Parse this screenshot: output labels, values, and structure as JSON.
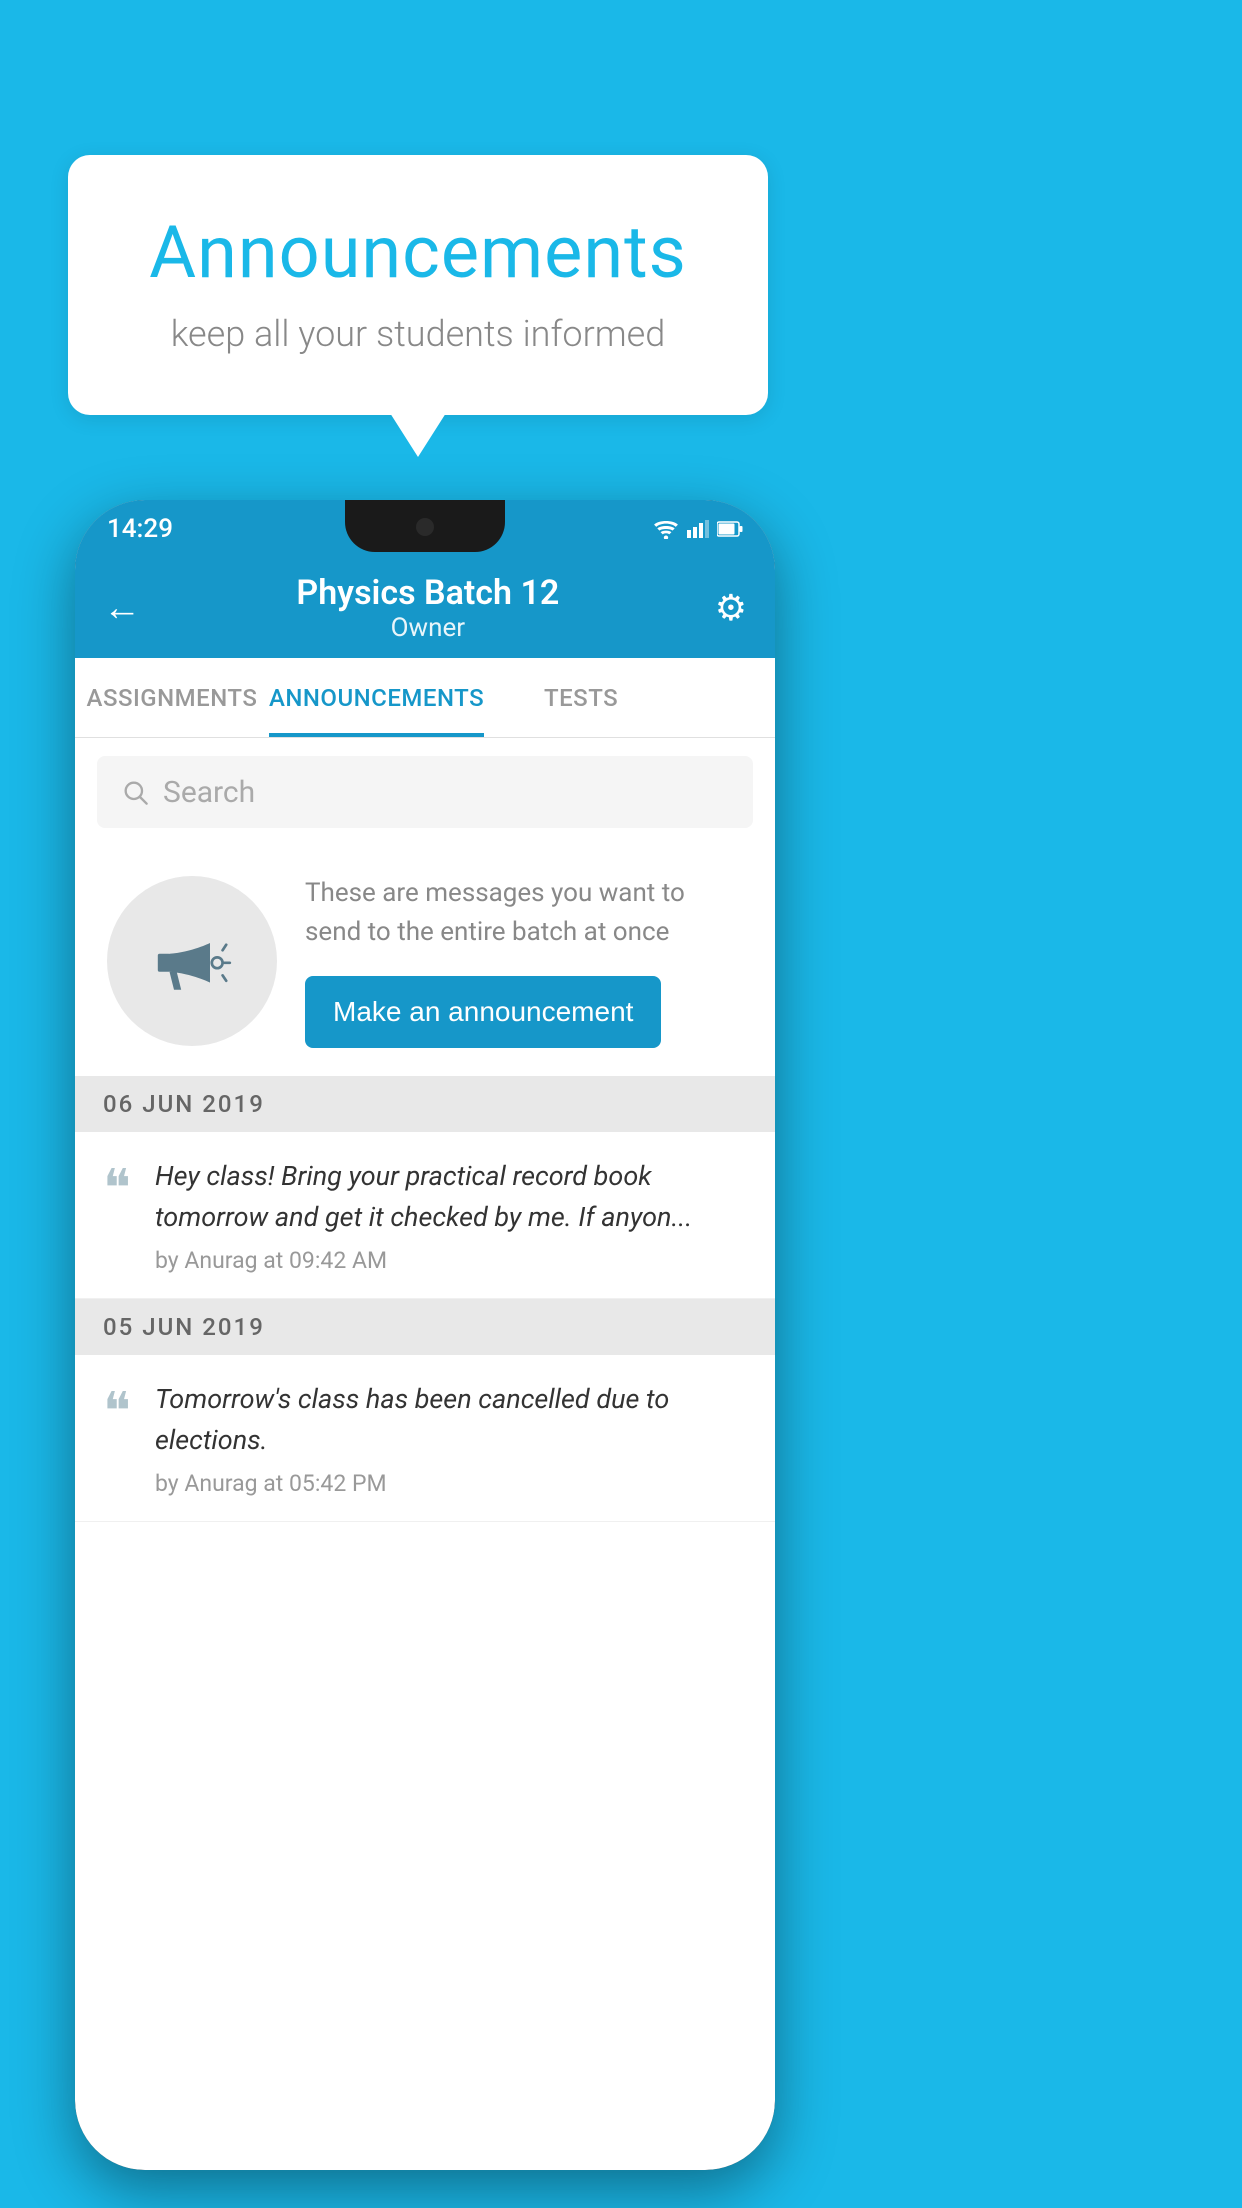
{
  "bubble": {
    "title": "Announcements",
    "subtitle": "keep all your students informed"
  },
  "phone": {
    "status_bar": {
      "time": "14:29"
    },
    "app_bar": {
      "batch_name": "Physics Batch 12",
      "batch_role": "Owner",
      "back_label": "←",
      "gear_label": "⚙"
    },
    "tabs": [
      {
        "label": "ASSIGNMENTS",
        "active": false
      },
      {
        "label": "ANNOUNCEMENTS",
        "active": true
      },
      {
        "label": "TESTS",
        "active": false
      }
    ],
    "search": {
      "placeholder": "Search"
    },
    "empty_state": {
      "description": "These are messages you want to send to the entire batch at once",
      "button_label": "Make an announcement"
    },
    "announcements": [
      {
        "date": "06  JUN  2019",
        "text": "Hey class! Bring your practical record book tomorrow and get it checked by me. If anyon...",
        "meta": "by Anurag at 09:42 AM"
      },
      {
        "date": "05  JUN  2019",
        "text": "Tomorrow's class has been cancelled due to elections.",
        "meta": "by Anurag at 05:42 PM"
      }
    ]
  }
}
